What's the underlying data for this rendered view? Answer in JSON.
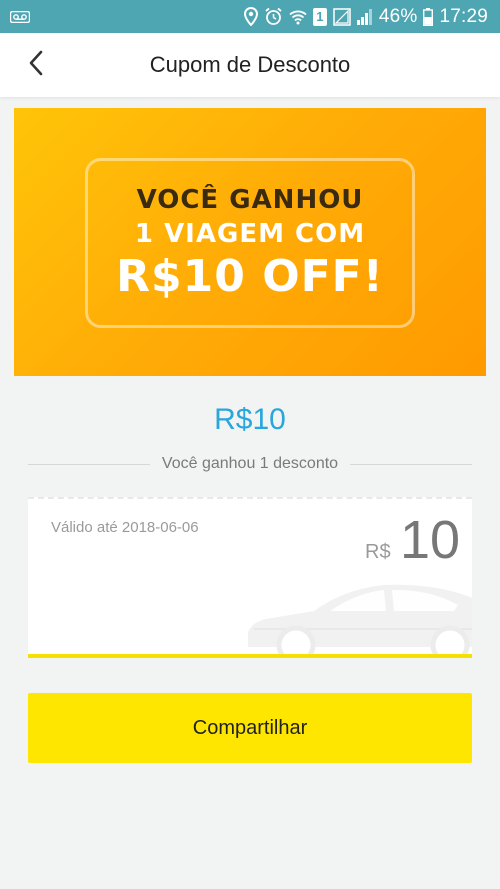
{
  "status_bar": {
    "battery": "46%",
    "time": "17:29",
    "sim": "1",
    "icons": [
      "voicemail-icon",
      "location-icon",
      "alarm-icon",
      "wifi-icon",
      "sim-icon",
      "signal-icon",
      "battery-icon"
    ]
  },
  "app_bar": {
    "title": "Cupom de Desconto",
    "back_icon": "chevron-left-icon"
  },
  "banner": {
    "line1": "VOCÊ GANHOU",
    "line2": "1 VIAGEM COM",
    "line3": "R$10 OFF!"
  },
  "amount": "R$10",
  "subtitle": "Você ganhou 1 desconto",
  "coupon": {
    "valid": "Válido até 2018-06-06",
    "currency": "R$",
    "value": "10",
    "illustration": "car-icon"
  },
  "share_button": "Compartilhar",
  "colors": {
    "status_bar": "#4fa6b3",
    "accent_blue": "#29a6dc",
    "button_yellow": "#ffe600",
    "banner_orange": "#ffab07"
  }
}
